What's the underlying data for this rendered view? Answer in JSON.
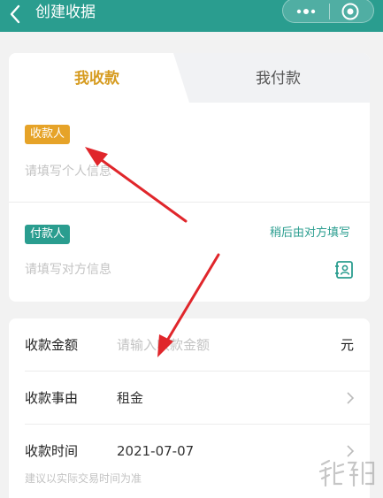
{
  "header": {
    "title": "创建收据",
    "back_icon": "chevron-left-icon",
    "more_icon": "more-dots-icon",
    "close_icon": "target-close-icon",
    "bg_color": "#2a9d8f"
  },
  "tabs": [
    {
      "label": "我收款",
      "active": true,
      "color": "#d69b1f"
    },
    {
      "label": "我付款",
      "active": false
    }
  ],
  "payee": {
    "tag": "收款人",
    "tag_color": "#e6a328",
    "placeholder": "请填写个人信息"
  },
  "payer": {
    "tag": "付款人",
    "tag_color": "#2a9d8f",
    "placeholder": "请填写对方信息",
    "later_link": "稍后由对方填写",
    "contact_icon": "contact-book-icon"
  },
  "form": {
    "amount": {
      "label": "收款金额",
      "placeholder": "请输入收款金额",
      "unit": "元"
    },
    "reason": {
      "label": "收款事由",
      "value": "租金"
    },
    "time": {
      "label": "收款时间",
      "value": "2021-07-07",
      "hint": "建议以实际交易时间为准"
    }
  },
  "annotations": {
    "arrow_color": "#e0262b"
  }
}
